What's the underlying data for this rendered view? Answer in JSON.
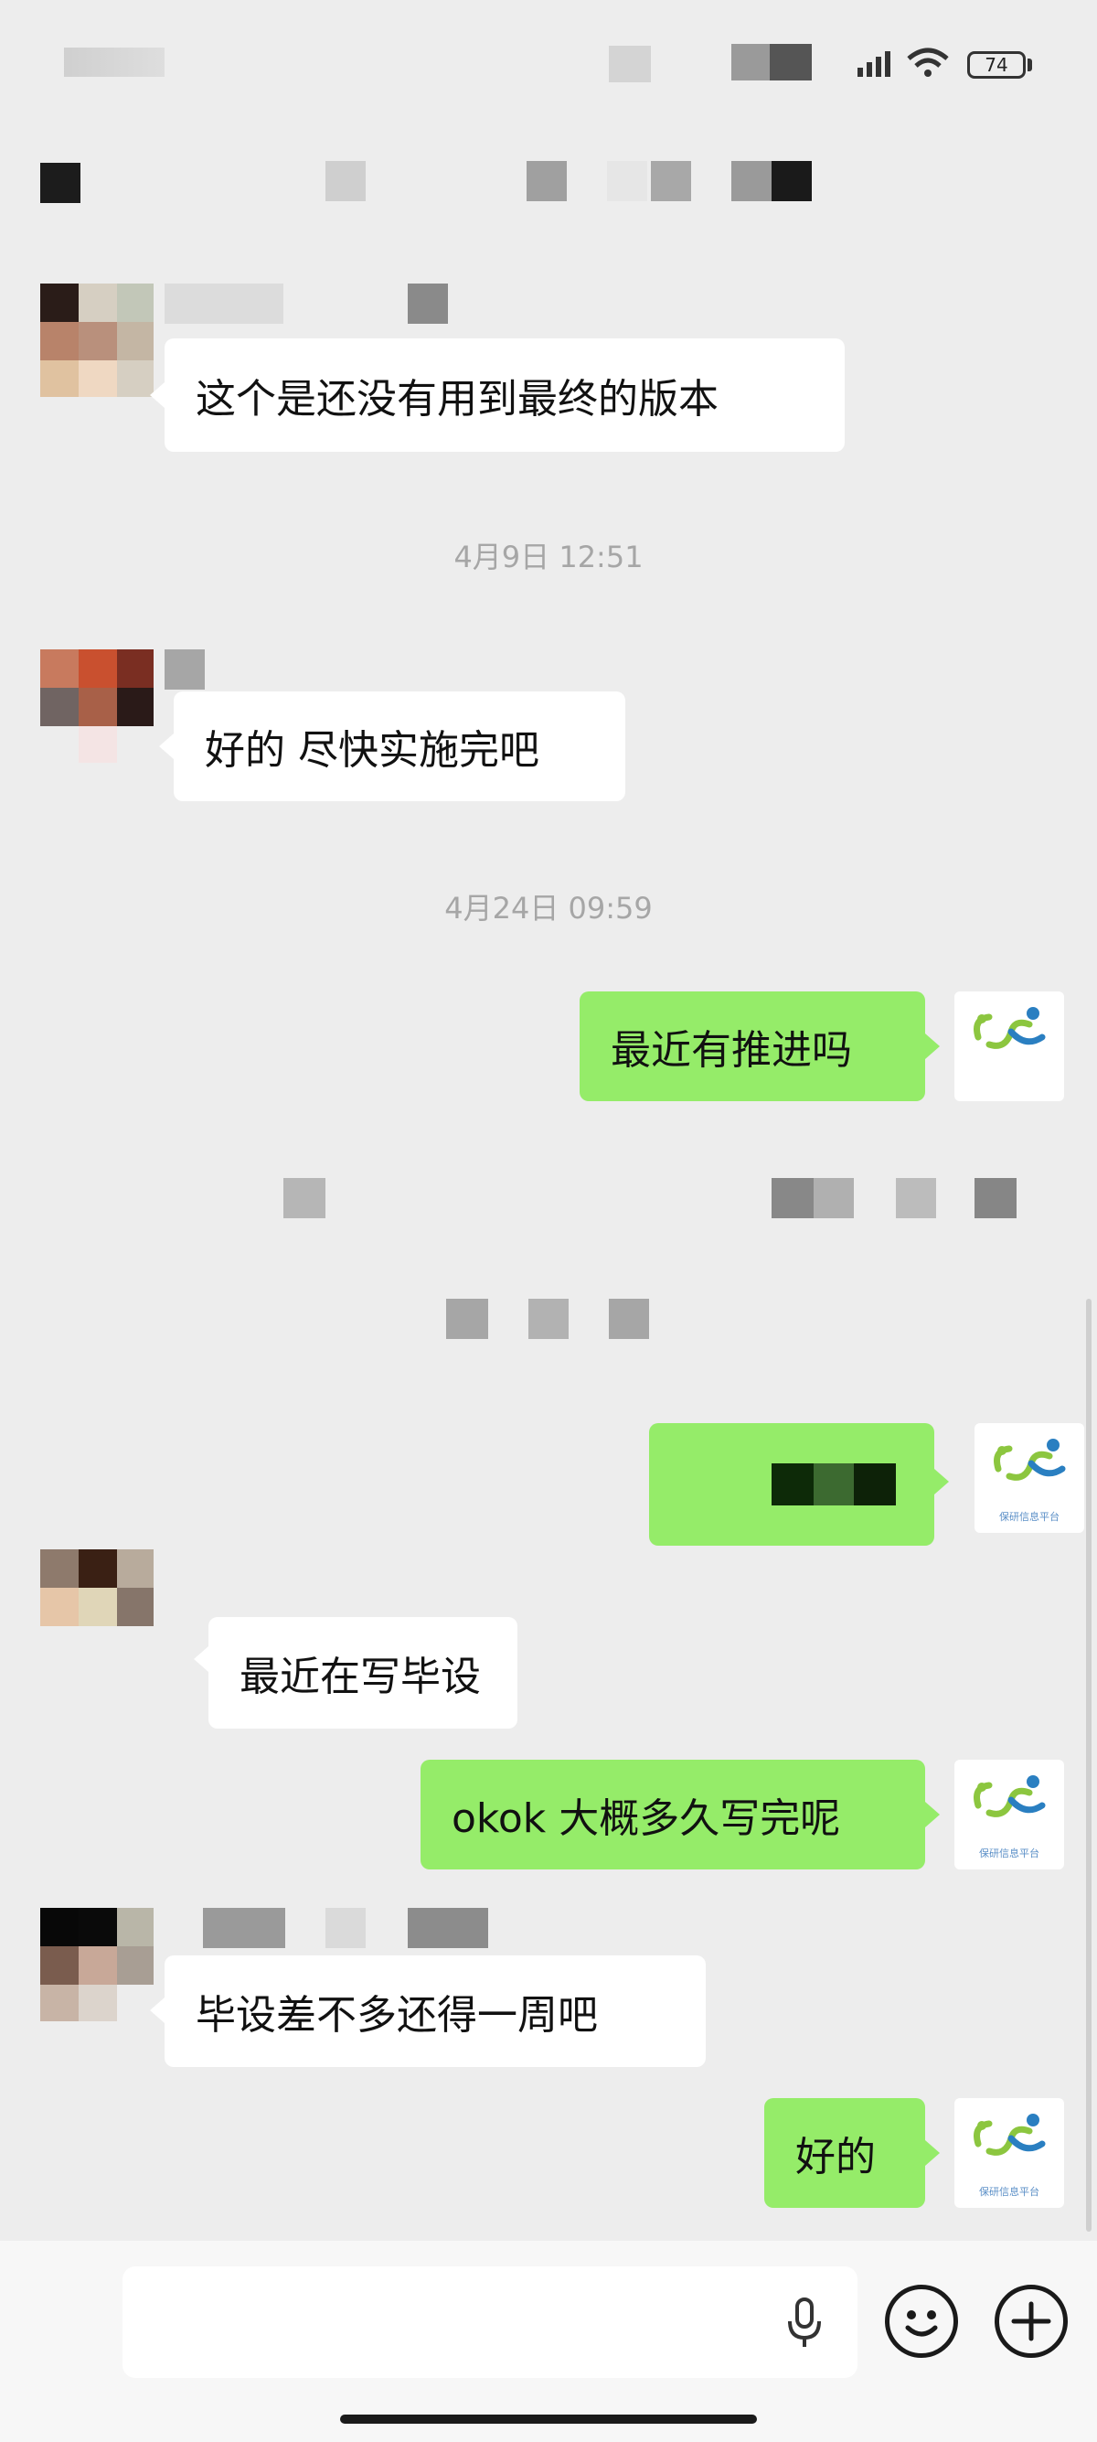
{
  "status_bar": {
    "time": "16:??",
    "battery": "74"
  },
  "messages": [
    {
      "side": "in",
      "text": "这个是还没有用到最终的版本"
    },
    {
      "type": "timestamp",
      "text": "4月9日 12:51"
    },
    {
      "side": "in",
      "text": "好的 尽快实施完吧"
    },
    {
      "type": "timestamp",
      "text": "4月24日 09:59"
    },
    {
      "side": "out",
      "text": "最近有推进吗"
    },
    {
      "side": "out",
      "text": ""
    },
    {
      "side": "in",
      "text": "最近在写毕设"
    },
    {
      "side": "out",
      "text": "okok 大概多久写完呢"
    },
    {
      "side": "in",
      "text": "毕设差不多还得一周吧"
    },
    {
      "side": "out",
      "text": "好的"
    }
  ],
  "my_avatar": {
    "caption": "保研信息平台"
  },
  "input_bar": {
    "placeholder": "",
    "icons": [
      "microphone-icon",
      "emoji-icon",
      "plus-icon"
    ]
  },
  "colors": {
    "background": "#ededed",
    "incoming_bubble": "#ffffff",
    "outgoing_bubble": "#95ec69",
    "timestamp": "#a6a6a6"
  }
}
